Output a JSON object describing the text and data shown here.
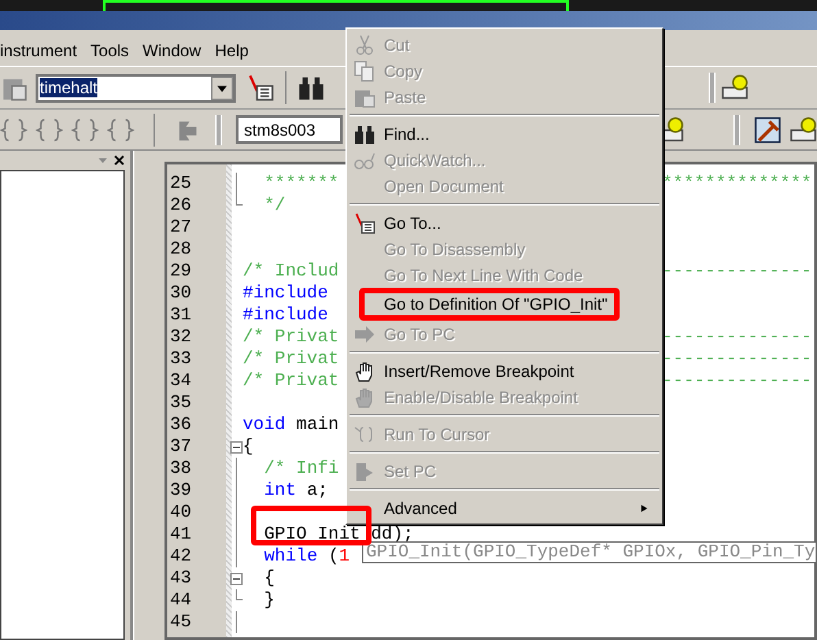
{
  "menu_bar": [
    {
      "label": "instrument"
    },
    {
      "label": "Tools"
    },
    {
      "label": "Window"
    },
    {
      "label": "Help"
    }
  ],
  "toolbar": {
    "symbol_combo": {
      "value": "timehalt",
      "text_selected": true
    },
    "target_combo": {
      "value": "stm8s003"
    }
  },
  "editor": {
    "lines": [
      {
        "number": "25",
        "segments": [
          {
            "text": "  *******",
            "kind": "comment"
          }
        ],
        "right": "**************"
      },
      {
        "number": "26",
        "segments": [
          {
            "text": "  */",
            "kind": "comment"
          }
        ]
      },
      {
        "number": "27"
      },
      {
        "number": "28"
      },
      {
        "number": "29",
        "segments": [
          {
            "text": "/* Includ",
            "kind": "comment"
          }
        ],
        "right": "--------------"
      },
      {
        "number": "30",
        "segments": [
          {
            "text": "#include",
            "kind": "keyword"
          }
        ]
      },
      {
        "number": "31",
        "segments": [
          {
            "text": "#include",
            "kind": "keyword"
          }
        ]
      },
      {
        "number": "32",
        "segments": [
          {
            "text": "/* Privat",
            "kind": "comment"
          }
        ],
        "right": "--------------"
      },
      {
        "number": "33",
        "segments": [
          {
            "text": "/* Privat",
            "kind": "comment"
          }
        ],
        "right": "--------------"
      },
      {
        "number": "34",
        "segments": [
          {
            "text": "/* Privat",
            "kind": "comment"
          }
        ],
        "right": "--------------"
      },
      {
        "number": "35"
      },
      {
        "number": "36",
        "segments": [
          {
            "text": "void",
            "kind": "keyword"
          },
          {
            "text": " main",
            "kind": "plain"
          }
        ]
      },
      {
        "number": "37",
        "segments": [
          {
            "text": "{",
            "kind": "plain"
          }
        ]
      },
      {
        "number": "38",
        "segments": [
          {
            "text": "  /* Infi",
            "kind": "comment"
          }
        ]
      },
      {
        "number": "39",
        "segments": [
          {
            "text": "  int",
            "kind": "keyword"
          },
          {
            "text": " a;",
            "kind": "plain"
          }
        ]
      },
      {
        "number": "40"
      },
      {
        "number": "41",
        "segments": [
          {
            "text": "  GPIO Init ",
            "kind": "plain"
          },
          {
            "text": "dd);",
            "kind": "plain"
          }
        ]
      },
      {
        "number": "42",
        "segments": [
          {
            "text": "  while",
            "kind": "keyword"
          },
          {
            "text": " (",
            "kind": "plain"
          },
          {
            "text": "1",
            "kind": "number"
          }
        ]
      },
      {
        "number": "43",
        "segments": [
          {
            "text": "  {",
            "kind": "plain"
          }
        ]
      },
      {
        "number": "44",
        "segments": [
          {
            "text": "  }",
            "kind": "plain"
          }
        ]
      },
      {
        "number": "45"
      }
    ]
  },
  "context_menu": [
    {
      "kind": "item",
      "label": "Cut",
      "disabled": true
    },
    {
      "kind": "item",
      "label": "Copy",
      "disabled": true
    },
    {
      "kind": "item",
      "label": "Paste",
      "disabled": true
    },
    {
      "kind": "separator"
    },
    {
      "kind": "item",
      "label": "Find...",
      "disabled": false
    },
    {
      "kind": "item",
      "label": "QuickWatch...",
      "disabled": true
    },
    {
      "kind": "item",
      "label": "Open Document",
      "disabled": true
    },
    {
      "kind": "separator"
    },
    {
      "kind": "item",
      "label": "Go To...",
      "disabled": false
    },
    {
      "kind": "item",
      "label": "Go To Disassembly",
      "disabled": true
    },
    {
      "kind": "item",
      "label": "Go To Next Line With Code",
      "disabled": true
    },
    {
      "kind": "item",
      "label": "Go to Definition Of \"GPIO_Init\"",
      "disabled": false
    },
    {
      "kind": "item",
      "label": "Go To PC",
      "disabled": true
    },
    {
      "kind": "separator"
    },
    {
      "kind": "item",
      "label": "Insert/Remove Breakpoint",
      "disabled": false
    },
    {
      "kind": "item",
      "label": "Enable/Disable Breakpoint",
      "disabled": true
    },
    {
      "kind": "separator"
    },
    {
      "kind": "item",
      "label": "Run To Cursor",
      "disabled": true
    },
    {
      "kind": "separator"
    },
    {
      "kind": "item",
      "label": "Set PC",
      "disabled": true
    },
    {
      "kind": "separator"
    },
    {
      "kind": "submenu",
      "label": "Advanced",
      "disabled": false
    }
  ],
  "tooltip": "GPIO_Init(GPIO_TypeDef* GPIOx, GPIO_Pin_Ty"
}
